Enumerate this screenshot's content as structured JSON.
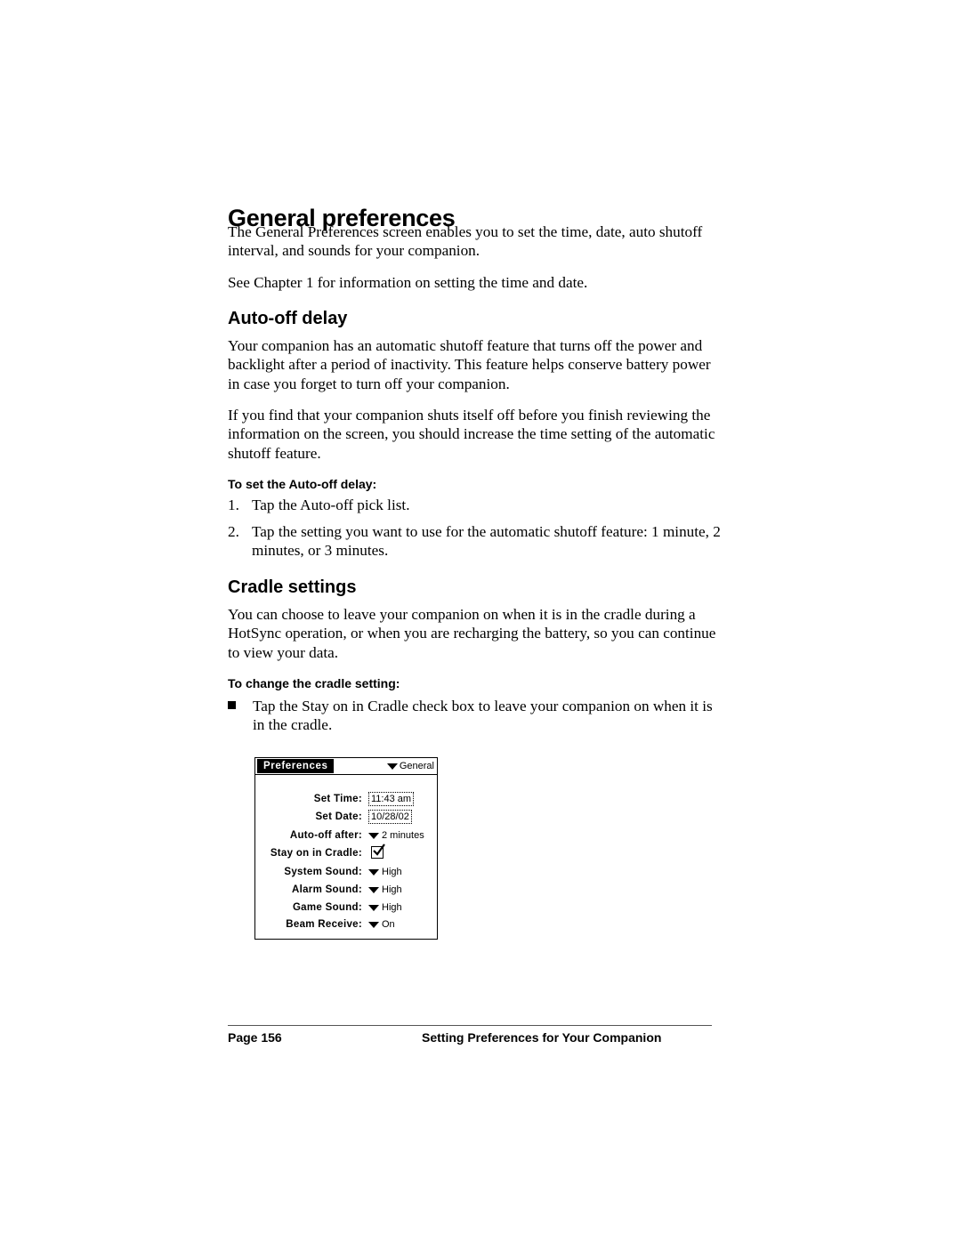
{
  "page": {
    "title": "General preferences",
    "intro": [
      "The General Preferences screen enables you to set the time, date, auto shutoff interval, and sounds for your companion.",
      "See Chapter 1 for information on setting the time and date."
    ],
    "sections": [
      {
        "heading": "Auto-off delay",
        "paragraphs": [
          "Your companion has an automatic shutoff feature that turns off the power and backlight after a period of inactivity. This feature helps conserve battery power in case you forget to turn off your companion.",
          "If you find that your companion shuts itself off before you finish reviewing the information on the screen, you should increase the time setting of the automatic shutoff feature."
        ],
        "procedure_title": "To set the Auto-off delay:",
        "steps": [
          {
            "num": "1.",
            "text": "Tap the Auto-off pick list."
          },
          {
            "num": "2.",
            "text": "Tap the setting you want to use for the automatic shutoff feature: 1 minute, 2 minutes, or 3 minutes."
          }
        ]
      },
      {
        "heading": "Cradle settings",
        "paragraphs": [
          "You can choose to leave your companion on when it is in the cradle during a HotSync operation, or when you are recharging the battery, so you can continue to view your data."
        ],
        "procedure_title": "To change the cradle setting:",
        "bullets": [
          "Tap the Stay on in Cradle check box to leave your companion on when it is in the cradle."
        ]
      }
    ]
  },
  "palm_screen": {
    "title": "Preferences",
    "category": "General",
    "rows": [
      {
        "label": "Set Time:",
        "value": "11:43 am",
        "kind": "dotted"
      },
      {
        "label": "Set Date:",
        "value": "10/28/02",
        "kind": "dotted"
      },
      {
        "label": "Auto-off after:",
        "value": "2 minutes",
        "kind": "picklist"
      },
      {
        "label": "Stay on in Cradle:",
        "value": "checked",
        "kind": "checkbox"
      },
      {
        "label": "System Sound:",
        "value": "High",
        "kind": "picklist"
      },
      {
        "label": "Alarm Sound:",
        "value": "High",
        "kind": "picklist"
      },
      {
        "label": "Game Sound:",
        "value": "High",
        "kind": "picklist"
      },
      {
        "label": "Beam Receive:",
        "value": "On",
        "kind": "picklist"
      }
    ]
  },
  "footer": {
    "page_label": "Page 156",
    "chapter_title": "Setting Preferences for Your Companion"
  }
}
